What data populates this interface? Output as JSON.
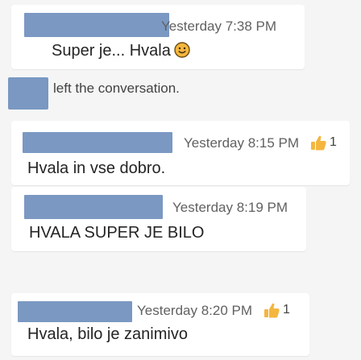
{
  "messages": [
    {
      "timestamp": "Yesterday 7:38 PM",
      "text": "Super je... Hvala",
      "emoji": "smile-emoji",
      "reaction": null
    },
    {
      "timestamp": "Yesterday 8:15 PM",
      "text": "Hvala in vse dobro.",
      "reaction": {
        "icon": "thumbs-up-emoji",
        "count": "1"
      }
    },
    {
      "timestamp": "Yesterday 8:19 PM",
      "text": "HVALA SUPER JE BILO",
      "reaction": null
    },
    {
      "timestamp": "Yesterday 8:20 PM",
      "text": "Hvala, bilo je zanimivo",
      "reaction": {
        "icon": "thumbs-up-emoji",
        "count": "1"
      }
    }
  ],
  "system_event": {
    "text": "left the conversation."
  },
  "colors": {
    "redaction": "#7a98c2",
    "reaction_emoji": "#f4b63f",
    "smile_emoji": "#f4b63f"
  }
}
